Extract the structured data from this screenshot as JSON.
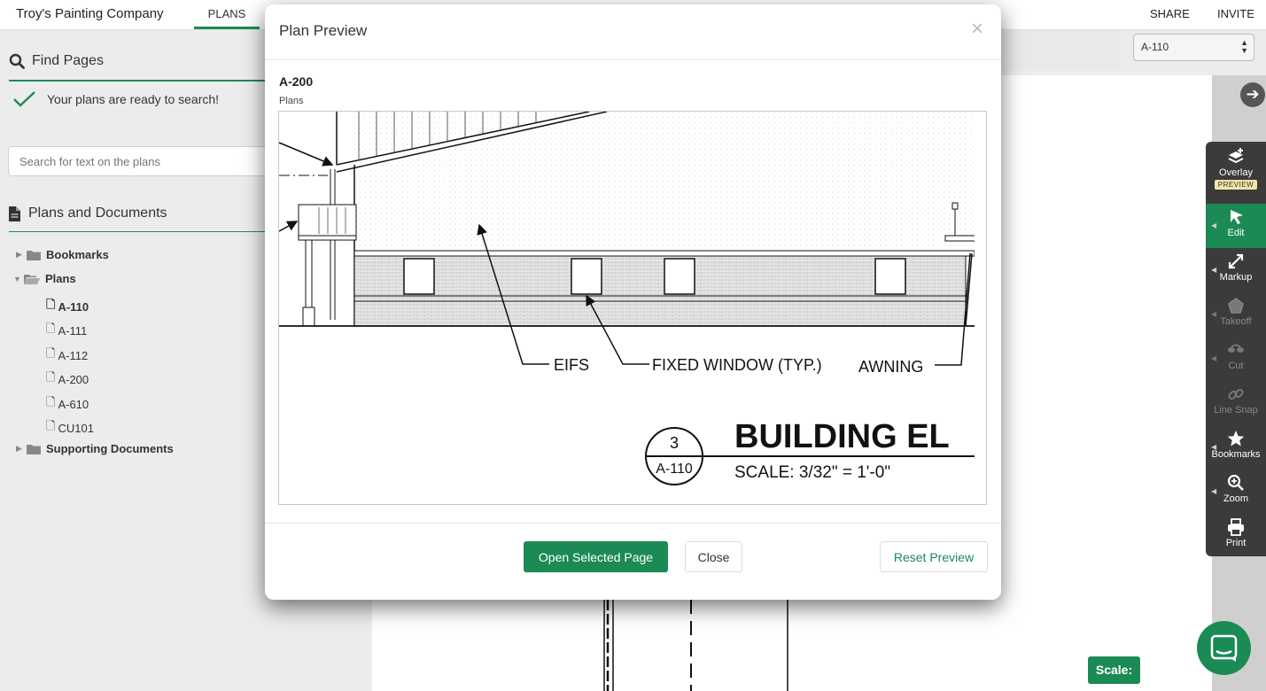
{
  "topbar": {
    "company": "Troy's Painting Company",
    "nav_plans": "PLANS",
    "share": "SHARE",
    "invite": "INVITE"
  },
  "sidebar": {
    "find_title": "Find Pages",
    "ready_text": "Your plans are ready to search!",
    "search_placeholder": "Search for text on the plans",
    "docs_title": "Plans and Documents",
    "tree": {
      "bookmarks": "Bookmarks",
      "plans": "Plans",
      "pages": [
        "A-110",
        "A-111",
        "A-112",
        "A-200",
        "A-610",
        "CU101"
      ],
      "supporting": "Supporting Documents"
    }
  },
  "viewer": {
    "page_select": "A-110",
    "scale_button": "Scale:"
  },
  "toolbar": {
    "overlay": "Overlay",
    "preview_badge": "PREVIEW",
    "edit": "Edit",
    "markup": "Markup",
    "takeoff": "Takeoff",
    "cut": "Cut",
    "line_snap": "Line Snap",
    "bookmarks": "Bookmarks",
    "zoom": "Zoom",
    "print": "Print"
  },
  "modal": {
    "title": "Plan Preview",
    "close_glyph": "×",
    "page_name": "A-200",
    "page_category": "Plans",
    "drawing": {
      "label_eifs": "EIFS",
      "label_window": "FIXED WINDOW (TYP.)",
      "label_awning": "AWNING",
      "detail_number": "3",
      "detail_sheet": "A-110",
      "title": "BUILDING EL",
      "scale": "SCALE: 3/32\" = 1'-0\""
    },
    "open_button": "Open Selected Page",
    "close_button": "Close",
    "reset_button": "Reset Preview"
  },
  "colors": {
    "brand_green": "#1c8a55",
    "toolbar_bg": "#3b3b3b",
    "sidebar_bg": "#ececec"
  }
}
